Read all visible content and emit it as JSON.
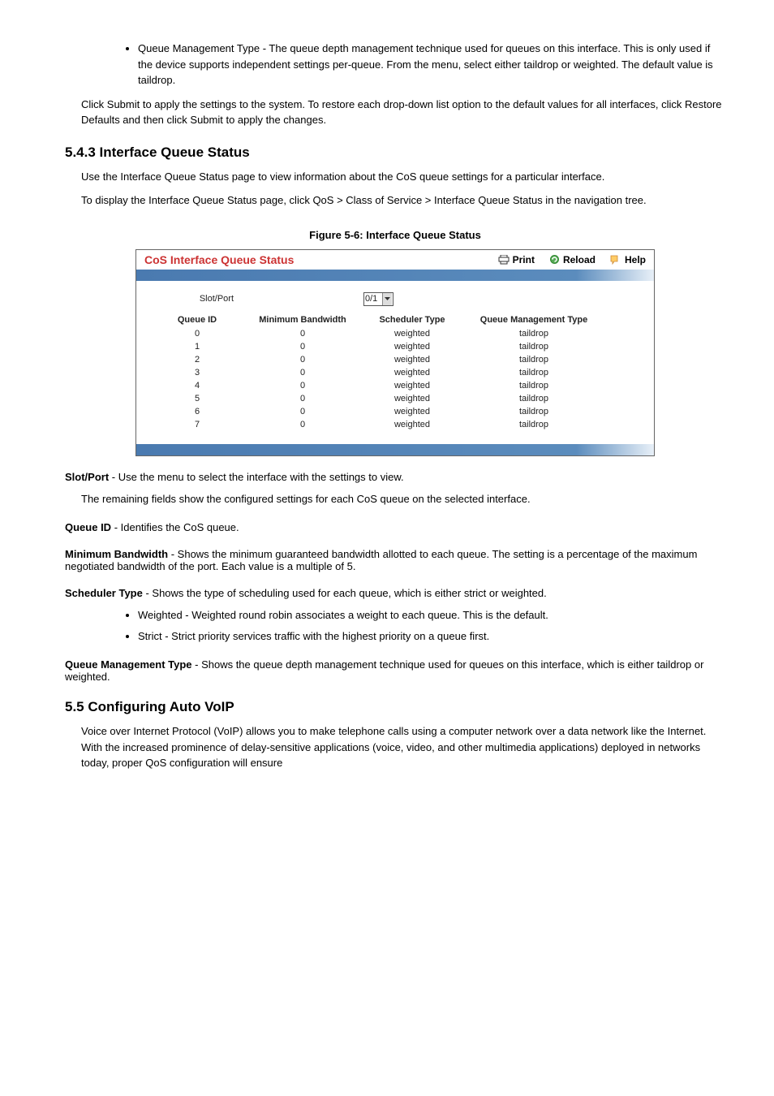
{
  "bullet_intro": "Queue Management Type - The queue depth management technique used for queues on this interface. This is only used if the device supports independent settings per-queue. From the menu, select either taildrop or weighted. The default value is taildrop.",
  "action_note": "Click Submit to apply the settings to the system. To restore each drop-down list option to the default values for all interfaces, click Restore Defaults and then click Submit to apply the changes.",
  "heading1": "5.4.3 Interface Queue Status",
  "para1": "Use the Interface Queue Status page to view information about the CoS queue settings for a particular interface.",
  "para2": "To display the Interface Queue Status page, click QoS > Class of Service > Interface Queue Status in the navigation tree.",
  "figure_caption": "Figure 5-6:  Interface Queue Status",
  "ss": {
    "title": "CoS Interface Queue Status",
    "print": "Print",
    "reload": "Reload",
    "help": "Help",
    "slot_port_label": "Slot/Port",
    "slot_port_value": "0/1",
    "headers": {
      "qid": "Queue ID",
      "minbw": "Minimum Bandwidth",
      "sched": "Scheduler Type",
      "qmt": "Queue Management Type"
    },
    "rows": [
      {
        "qid": "0",
        "minbw": "0",
        "sched": "weighted",
        "qmt": "taildrop"
      },
      {
        "qid": "1",
        "minbw": "0",
        "sched": "weighted",
        "qmt": "taildrop"
      },
      {
        "qid": "2",
        "minbw": "0",
        "sched": "weighted",
        "qmt": "taildrop"
      },
      {
        "qid": "3",
        "minbw": "0",
        "sched": "weighted",
        "qmt": "taildrop"
      },
      {
        "qid": "4",
        "minbw": "0",
        "sched": "weighted",
        "qmt": "taildrop"
      },
      {
        "qid": "5",
        "minbw": "0",
        "sched": "weighted",
        "qmt": "taildrop"
      },
      {
        "qid": "6",
        "minbw": "0",
        "sched": "weighted",
        "qmt": "taildrop"
      },
      {
        "qid": "7",
        "minbw": "0",
        "sched": "weighted",
        "qmt": "taildrop"
      }
    ]
  },
  "config1_label": "Slot/Port",
  "config1_text": " - Use the menu to select the interface with the settings to view.",
  "config2": "The remaining fields show the configured settings for each CoS queue on the selected interface.",
  "config3_label": "Queue ID",
  "config3_text": " - Identifies the CoS queue.",
  "config4_label": "Minimum Bandwidth",
  "config4_text": " - Shows the minimum guaranteed bandwidth allotted to each queue. The setting is a percentage of the maximum negotiated bandwidth of the port. Each value is a multiple of 5.",
  "config5_label": "Scheduler Type",
  "config5_text": " - Shows the type of scheduling used for each queue, which is either strict or weighted.",
  "bullets2": [
    "Weighted - Weighted round robin associates a weight to each queue. This is the default.",
    "Strict - Strict priority services traffic with the highest priority on a queue first."
  ],
  "config6_label": "Queue Management Type",
  "config6_text": " - Shows the queue depth management technique used for queues on this interface, which is either taildrop or weighted.",
  "heading2": "5.5 Configuring Auto VoIP",
  "para3": "Voice over Internet Protocol (VoIP) allows you to make telephone calls using a computer network over a data network like the Internet. With the increased prominence of delay-sensitive applications (voice, video, and other multimedia applications) deployed in networks today, proper QoS configuration will ensure"
}
